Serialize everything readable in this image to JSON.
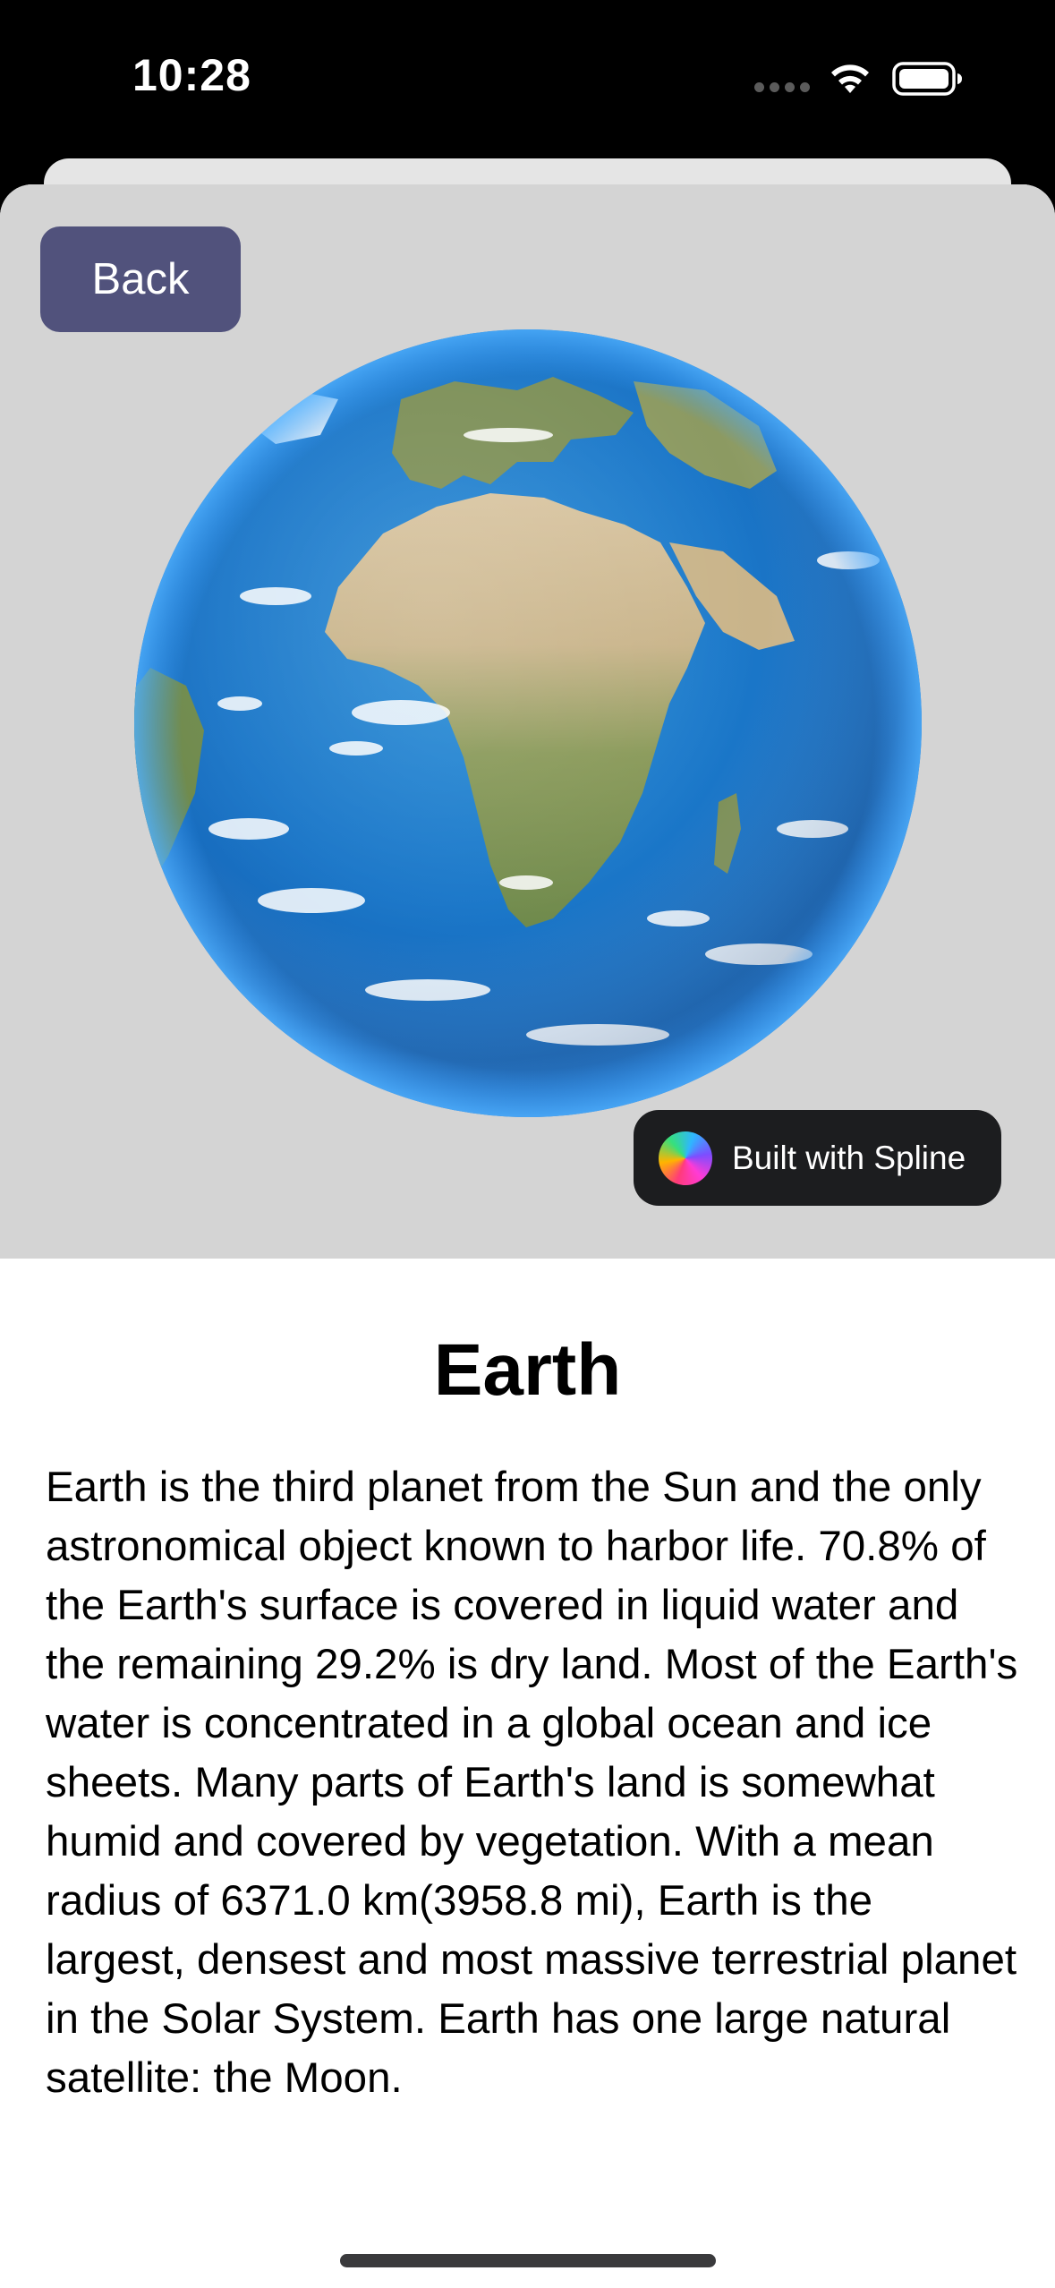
{
  "status_bar": {
    "time": "10:28",
    "icons": [
      "signal-dots-icon",
      "wifi-icon",
      "battery-icon"
    ]
  },
  "viewer": {
    "back_label": "Back",
    "badge_label": "Built with Spline",
    "background_color": "#d4d4d4",
    "back_button_color": "#51527c"
  },
  "planet": {
    "name": "Earth",
    "description": "Earth is the third planet from the Sun and the only astronomical object known to harbor life. 70.8% of the Earth's surface is covered in liquid water and the remaining 29.2% is dry land. Most of the Earth's water is concentrated in a global ocean and ice sheets. Many parts of Earth's land is somewhat humid and covered by vegetation. With a mean radius of 6371.0 km(3958.8 mi), Earth is the largest, densest and most massive terrestrial planet in the Solar System. Earth has one large natural satellite: the Moon."
  }
}
